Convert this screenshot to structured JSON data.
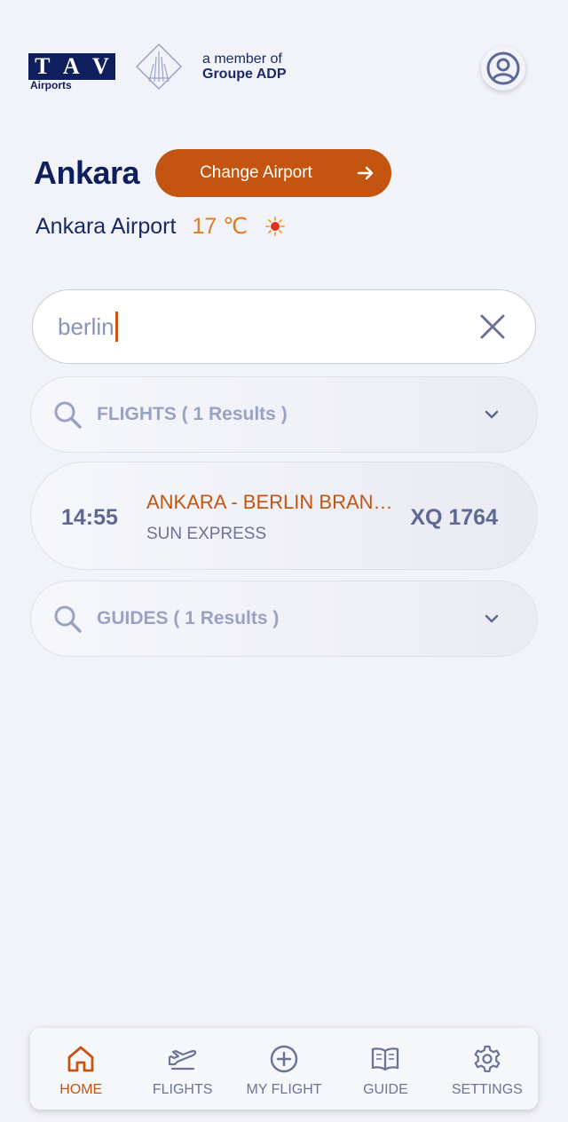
{
  "header": {
    "logo_letters": [
      "T",
      "A",
      "V"
    ],
    "logo_sub": "Airports",
    "member_line1": "a member of",
    "member_line2": "Groupe ADP",
    "profile_icon": "user-circle-icon"
  },
  "location": {
    "city": "Ankara",
    "change_airport_label": "Change Airport",
    "airport_name": "Ankara Airport",
    "temperature": "17 ℃",
    "weather_icon": "sun-icon"
  },
  "search": {
    "value": "berlin",
    "clear_icon": "close-icon"
  },
  "results": {
    "flights_label": "FLIGHTS ( 1 Results )",
    "guides_label": "GUIDES ( 1 Results )",
    "flights": [
      {
        "time": "14:55",
        "route": "ANKARA -  BERLIN BRANDENBURG",
        "airline": "SUN EXPRESS",
        "flight_no": "XQ 1764"
      }
    ]
  },
  "nav": {
    "items": [
      {
        "label": "HOME",
        "icon": "home-icon",
        "active": true
      },
      {
        "label": "FLIGHTS",
        "icon": "plane-icon",
        "active": false
      },
      {
        "label": "MY FLIGHT",
        "icon": "plus-circle-icon",
        "active": false
      },
      {
        "label": "GUIDE",
        "icon": "book-icon",
        "active": false
      },
      {
        "label": "SETTINGS",
        "icon": "gear-icon",
        "active": false
      }
    ]
  },
  "colors": {
    "brand_navy": "#0f1f5e",
    "accent_orange": "#c45511",
    "temperature_orange": "#e07a1f",
    "muted_text": "#6b7396"
  }
}
